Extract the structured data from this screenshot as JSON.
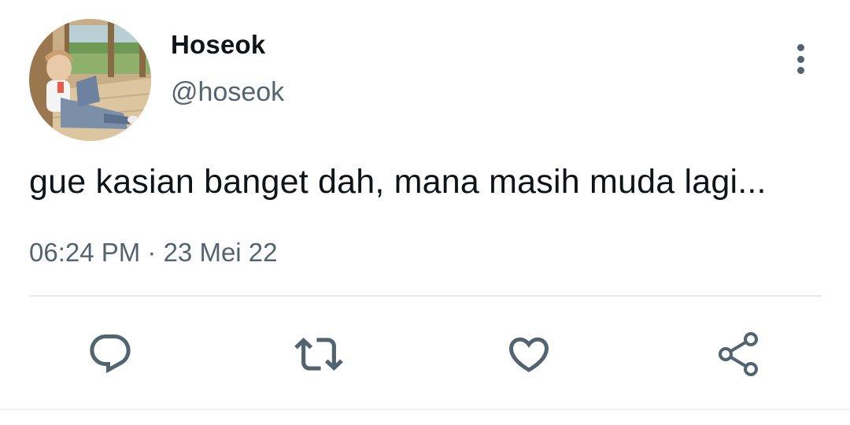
{
  "tweet": {
    "author": {
      "display_name": "Hoseok",
      "handle": "@hoseok"
    },
    "text": "gue kasian banget dah, mana masih muda lagi...",
    "timestamp": "06:24 PM · 23 Mei 22"
  },
  "actions": [
    {
      "name": "reply",
      "icon": "reply-icon"
    },
    {
      "name": "retweet",
      "icon": "retweet-icon"
    },
    {
      "name": "like",
      "icon": "heart-icon"
    },
    {
      "name": "share",
      "icon": "share-icon"
    }
  ],
  "colors": {
    "text_primary": "#0f1419",
    "text_secondary": "#536471",
    "divider": "#e7eaed"
  }
}
